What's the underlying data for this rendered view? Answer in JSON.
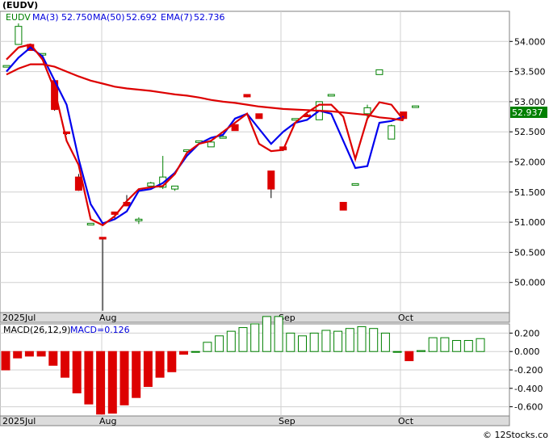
{
  "header": {
    "title": "(EUDV)",
    "legend": [
      {
        "label": "EUDV",
        "color": "#008000"
      },
      {
        "label": "MA(3)",
        "value": "52.750",
        "color": "#0000dd"
      },
      {
        "label": "MA(50)",
        "value": "52.692",
        "color": "#0000dd"
      },
      {
        "label": "EMA(7)",
        "value": "52.736",
        "color": "#0000dd"
      }
    ]
  },
  "price_badge": "52.937",
  "macd_legend": {
    "label": "MACD(26,12,9)",
    "value_label": "MACD=0.126"
  },
  "x_axis_labels": [
    "2025Jul",
    "Aug",
    "Sep",
    "Oct"
  ],
  "watermark": "© 12Stocks.com",
  "colors": {
    "up": "#008000",
    "down": "#dd0000",
    "ma3": "#0000ee",
    "ma50": "#dd0000",
    "ema7": "#dd0000"
  },
  "chart_data": [
    {
      "type": "candlestick",
      "title": "(EUDV)",
      "ylim": [
        49.5,
        54.5
      ],
      "y_ticks": [
        "54.000",
        "53.500",
        "53.000",
        "52.500",
        "52.000",
        "51.500",
        "51.000",
        "50.500",
        "50.000"
      ],
      "x_tick_labels": [
        "2025Jul",
        "Aug",
        "Sep",
        "Oct"
      ],
      "candles": [
        {
          "o": 53.6,
          "h": 53.6,
          "l": 53.6,
          "c": 53.6
        },
        {
          "o": 53.95,
          "h": 54.3,
          "l": 53.95,
          "c": 54.25
        },
        {
          "o": 53.95,
          "h": 53.95,
          "l": 53.85,
          "c": 53.85
        },
        {
          "o": 53.8,
          "h": 53.8,
          "l": 53.8,
          "c": 53.8
        },
        {
          "o": 53.35,
          "h": 53.35,
          "l": 52.85,
          "c": 52.87
        },
        {
          "o": 52.5,
          "h": 52.5,
          "l": 52.45,
          "c": 52.47
        },
        {
          "o": 51.75,
          "h": 51.8,
          "l": 51.52,
          "c": 51.53
        },
        {
          "o": 50.98,
          "h": 50.98,
          "l": 50.98,
          "c": 50.98
        },
        {
          "o": 50.75,
          "h": 50.75,
          "l": 49.53,
          "c": 50.72
        },
        {
          "o": 51.17,
          "h": 51.17,
          "l": 51.05,
          "c": 51.13
        },
        {
          "o": 51.33,
          "h": 51.45,
          "l": 51.27,
          "c": 51.27
        },
        {
          "o": 51.05,
          "h": 51.08,
          "l": 50.97,
          "c": 51.05
        },
        {
          "o": 51.6,
          "h": 51.67,
          "l": 51.6,
          "c": 51.65
        },
        {
          "o": 51.58,
          "h": 52.1,
          "l": 51.55,
          "c": 51.75
        },
        {
          "o": 51.55,
          "h": 51.6,
          "l": 51.52,
          "c": 51.6
        },
        {
          "o": 52.2,
          "h": 52.2,
          "l": 52.18,
          "c": 52.2
        },
        {
          "o": 52.35,
          "h": 52.35,
          "l": 52.35,
          "c": 52.35
        },
        {
          "o": 52.25,
          "h": 52.35,
          "l": 52.25,
          "c": 52.33
        },
        {
          "o": 52.42,
          "h": 52.44,
          "l": 52.42,
          "c": 52.42
        },
        {
          "o": 52.62,
          "h": 52.62,
          "l": 52.52,
          "c": 52.52
        },
        {
          "o": 53.12,
          "h": 53.12,
          "l": 53.07,
          "c": 53.08
        },
        {
          "o": 52.8,
          "h": 52.8,
          "l": 52.72,
          "c": 52.72
        },
        {
          "o": 51.85,
          "h": 51.85,
          "l": 51.4,
          "c": 51.55
        },
        {
          "o": 52.25,
          "h": 52.25,
          "l": 52.18,
          "c": 52.2
        },
        {
          "o": 52.72,
          "h": 52.72,
          "l": 52.72,
          "c": 52.72
        },
        {
          "o": 52.78,
          "h": 52.8,
          "l": 52.75,
          "c": 52.75
        },
        {
          "o": 52.7,
          "h": 53.0,
          "l": 52.7,
          "c": 53.0
        },
        {
          "o": 53.12,
          "h": 53.12,
          "l": 53.12,
          "c": 53.12
        },
        {
          "o": 51.33,
          "h": 51.33,
          "l": 51.2,
          "c": 51.2
        },
        {
          "o": 51.62,
          "h": 51.64,
          "l": 51.62,
          "c": 51.64
        },
        {
          "o": 52.8,
          "h": 52.95,
          "l": 52.7,
          "c": 52.9
        },
        {
          "o": 53.45,
          "h": 53.53,
          "l": 53.45,
          "c": 53.53
        },
        {
          "o": 52.38,
          "h": 52.62,
          "l": 52.38,
          "c": 52.6
        },
        {
          "o": 52.83,
          "h": 52.83,
          "l": 52.7,
          "c": 52.72
        },
        {
          "o": 52.93,
          "h": 52.93,
          "l": 52.93,
          "c": 52.93
        }
      ],
      "series": [
        {
          "name": "MA(3)",
          "color": "#0000ee",
          "values": [
            53.5,
            53.73,
            53.9,
            53.75,
            53.35,
            52.95,
            52.05,
            51.3,
            50.98,
            51.05,
            51.18,
            51.52,
            51.55,
            51.65,
            51.82,
            52.1,
            52.3,
            52.4,
            52.45,
            52.72,
            52.8,
            52.55,
            52.3,
            52.5,
            52.65,
            52.7,
            52.85,
            52.8,
            52.35,
            51.9,
            51.93,
            52.65,
            52.68,
            52.75
          ]
        },
        {
          "name": "MA(50)",
          "color": "#dd0000",
          "values": [
            53.45,
            53.55,
            53.62,
            53.62,
            53.58,
            53.5,
            53.42,
            53.35,
            53.3,
            53.25,
            53.22,
            53.2,
            53.18,
            53.15,
            53.12,
            53.1,
            53.07,
            53.03,
            53.0,
            52.98,
            52.95,
            52.92,
            52.9,
            52.88,
            52.87,
            52.86,
            52.85,
            52.84,
            52.82,
            52.8,
            52.78,
            52.74,
            52.72,
            52.69
          ]
        },
        {
          "name": "EMA(7)",
          "color": "#dd0000",
          "values": [
            53.7,
            53.9,
            53.95,
            53.7,
            53.2,
            52.35,
            51.95,
            51.05,
            50.95,
            51.1,
            51.35,
            51.55,
            51.58,
            51.6,
            51.8,
            52.15,
            52.3,
            52.35,
            52.5,
            52.65,
            52.8,
            52.3,
            52.18,
            52.2,
            52.65,
            52.82,
            52.95,
            52.95,
            52.75,
            52.05,
            52.72,
            52.99,
            52.95,
            52.7
          ]
        }
      ]
    },
    {
      "type": "bar",
      "title": "MACD(26,12,9)",
      "ylim": [
        -0.7,
        0.3
      ],
      "y_ticks": [
        "0.200",
        "0.000",
        "-0.200",
        "-0.400",
        "-0.600"
      ],
      "values": [
        -0.2,
        -0.07,
        -0.05,
        -0.05,
        -0.15,
        -0.28,
        -0.45,
        -0.57,
        -0.68,
        -0.67,
        -0.58,
        -0.5,
        -0.38,
        -0.28,
        -0.22,
        -0.03,
        0.0,
        0.1,
        0.17,
        0.22,
        0.26,
        0.3,
        0.38,
        0.38,
        0.2,
        0.17,
        0.2,
        0.23,
        0.22,
        0.25,
        0.27,
        0.25,
        0.2,
        0.0,
        -0.1,
        0.01,
        0.15,
        0.15,
        0.12,
        0.12,
        0.14
      ]
    }
  ]
}
